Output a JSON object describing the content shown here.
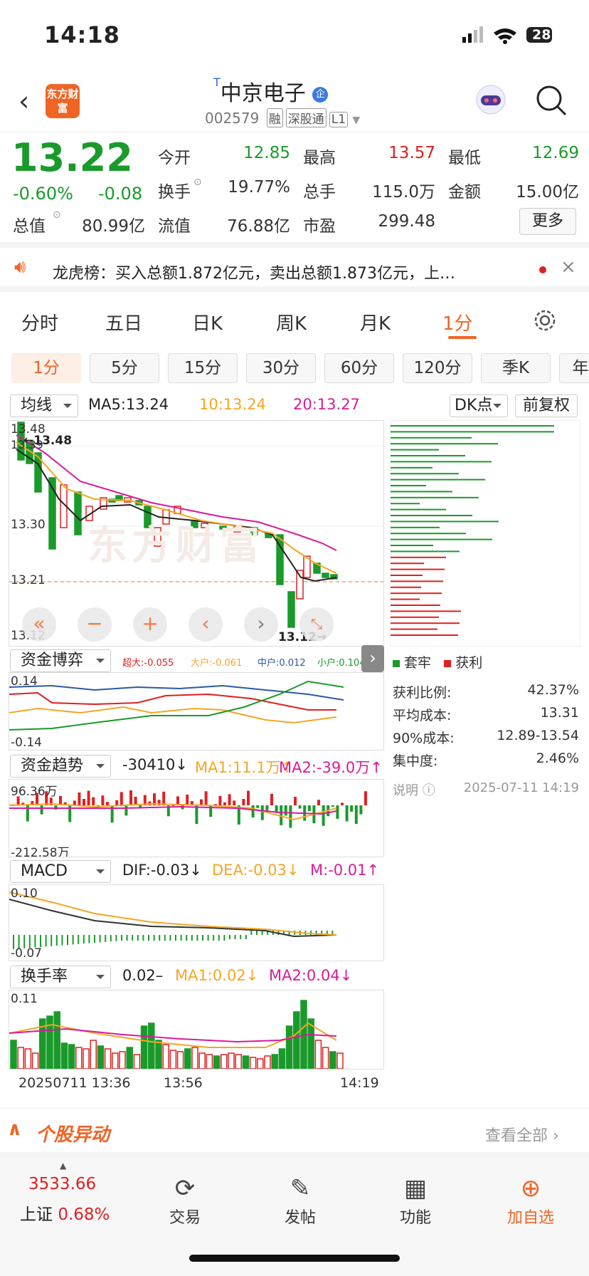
{
  "status": {
    "time": "14:18",
    "battery": "28"
  },
  "header": {
    "logo": "东方财富",
    "name": "中京电子",
    "badge": "企",
    "code": "002579",
    "tags": [
      "融",
      "深股通",
      "L1"
    ]
  },
  "quote": {
    "price": "13.22",
    "pct": "-0.60%",
    "chg": "-0.08",
    "fields": [
      {
        "label": "今开",
        "value": "12.85",
        "color": "#1a9a2a"
      },
      {
        "label": "最高",
        "value": "13.57",
        "color": "#e02020"
      },
      {
        "label": "最低",
        "value": "12.69",
        "color": "#1a9a2a"
      },
      {
        "label": "换手",
        "value": "19.77%",
        "color": "#333"
      },
      {
        "label": "总手",
        "value": "115.0万",
        "color": "#333"
      },
      {
        "label": "金额",
        "value": "15.00亿",
        "color": "#333"
      },
      {
        "label": "总值",
        "value": "80.99亿",
        "color": "#333"
      },
      {
        "label": "流值",
        "value": "76.88亿",
        "color": "#333"
      },
      {
        "label": "市盈",
        "value": "299.48",
        "color": "#333"
      }
    ],
    "more": "更多"
  },
  "notice": {
    "text": "龙虎榜：买入总额1.872亿元，卖出总额1.873亿元，上…"
  },
  "tabs": [
    "分时",
    "五日",
    "日K",
    "周K",
    "月K",
    "1分"
  ],
  "period_tabs": [
    "1分",
    "5分",
    "15分",
    "30分",
    "60分",
    "120分",
    "季K",
    "年"
  ],
  "kline": {
    "selector": "均线",
    "ma5": "MA5:13.24",
    "ma10": "10:13.24",
    "ma20": "20:13.27",
    "dk": "DK点",
    "fq": "前复权",
    "ymax": "13.48",
    "y2": "13.39",
    "y3": "13.30",
    "y4": "13.21",
    "ymin": "13.12",
    "hi_mark": "13.48",
    "lo_mark": "13.12",
    "watermark": "东方财富"
  },
  "chip": {
    "legend1": "套牢",
    "legend2": "获利",
    "rows": [
      {
        "label": "获利比例:",
        "value": "42.37%"
      },
      {
        "label": "平均成本:",
        "value": "13.31"
      },
      {
        "label": "90%成本:",
        "value": "12.89-13.54"
      },
      {
        "label": "集中度:",
        "value": "2.46%"
      }
    ],
    "note": "说明",
    "date": "2025-07-11 14:19"
  },
  "funds": {
    "selector": "资金博弈",
    "super": "超大:-0.055",
    "big": "大户:-0.061",
    "mid": "中户:0.012",
    "small": "小户:0.104",
    "ymax": "0.14",
    "ymin": "-0.14"
  },
  "trend": {
    "selector": "资金趋势",
    "val": "-30410",
    "ma1": "MA1:11.1万",
    "ma2": "MA2:-39.0万",
    "ymax": "96.36万",
    "ymin": "-212.58万"
  },
  "macd": {
    "selector": "MACD",
    "dif": "DIF:-0.03",
    "dea": "DEA:-0.03",
    "m": "M:-0.01",
    "ymax": "0.10",
    "ymin": "-0.07"
  },
  "turnover": {
    "selector": "换手率",
    "val": "0.02",
    "ma1": "MA1:0.02",
    "ma2": "MA2:0.04",
    "ymax": "0.11",
    "t1": "20250711 13:36",
    "t2": "13:56",
    "t3": "14:19"
  },
  "section": {
    "title": "个股异动",
    "link": "查看全部"
  },
  "bottom": {
    "index_val": "3533.66",
    "index_name": "上证",
    "index_pct": "0.68%",
    "items": [
      "交易",
      "发帖",
      "功能",
      "加自选"
    ]
  },
  "colors": {
    "up": "#e02020",
    "down": "#1a9a2a",
    "accent": "#f06424",
    "ma5": "#222222",
    "ma10": "#f5a623",
    "ma20": "#d81b9b"
  }
}
